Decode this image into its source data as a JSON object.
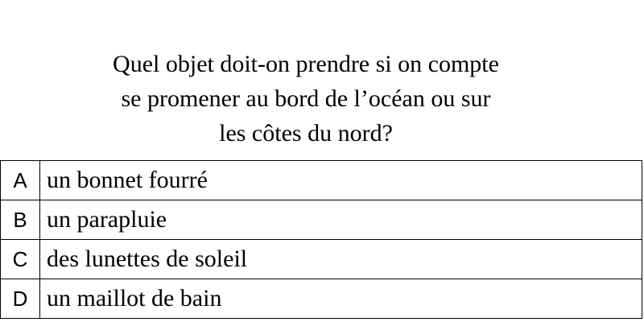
{
  "question": {
    "lines": [
      "Quel objet doit-on prendre si on compte",
      "se promener au bord de l’océan ou sur",
      "les côtes du nord?"
    ]
  },
  "options": [
    {
      "letter": "A",
      "text": "un bonnet fourré"
    },
    {
      "letter": "B",
      "text": "un parapluie"
    },
    {
      "letter": "C",
      "text": "des lunettes de soleil"
    },
    {
      "letter": "D",
      "text": "un maillot de bain"
    }
  ]
}
